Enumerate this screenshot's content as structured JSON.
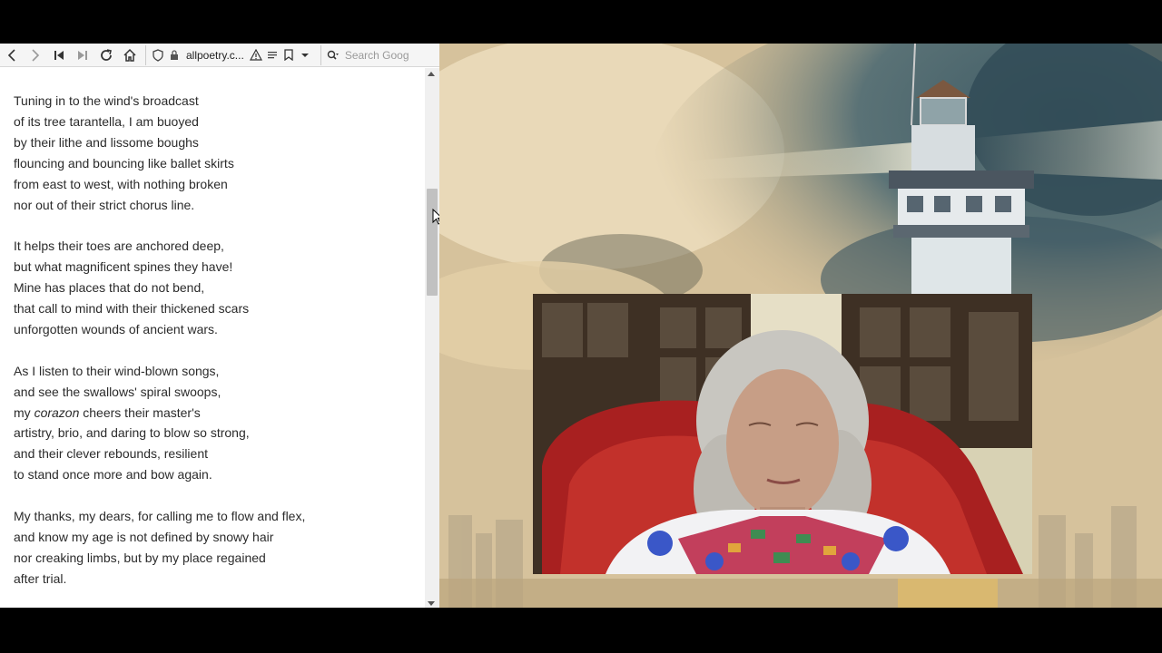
{
  "browser": {
    "url": "allpoetry.c...",
    "search_placeholder": "Search Goog"
  },
  "poem": {
    "stanzas": [
      [
        "Tuning in to the wind's broadcast",
        "of its tree tarantella, I am buoyed",
        "by their lithe and lissome boughs",
        "flouncing and bouncing like ballet skirts",
        "from east to west, with nothing broken",
        "nor out of their strict chorus line."
      ],
      [
        "It helps their toes are anchored deep,",
        "but what magnificent spines they have!",
        "Mine has places that do not bend,",
        "that call to mind with their thickened scars",
        "unforgotten wounds of ancient wars."
      ],
      [
        "As I listen to their wind-blown songs,",
        "and see the swallows' spiral swoops,",
        "my ",
        "corazon",
        " cheers their master's",
        "artistry, brio, and daring to blow so strong,",
        "and their clever rebounds, resilient",
        "to stand once more and bow again."
      ],
      [
        "My thanks, my dears, for calling me to flow and flex,",
        "and know my age is not defined by snowy hair",
        "nor creaking limbs, but by my place regained",
        "after trial."
      ]
    ]
  },
  "icons": [
    "back-icon",
    "forward-icon",
    "skip-start-icon",
    "skip-end-icon",
    "reload-icon",
    "home-icon",
    "shield-icon",
    "lock-icon",
    "warning-icon",
    "reader-icon",
    "bookmark-icon",
    "dropdown-icon",
    "search-icon"
  ],
  "colors": {
    "page_bg": "#ffffff",
    "text": "#2b2b2b",
    "toolbar": "#f5f5f5",
    "chair": "#b3211f"
  }
}
